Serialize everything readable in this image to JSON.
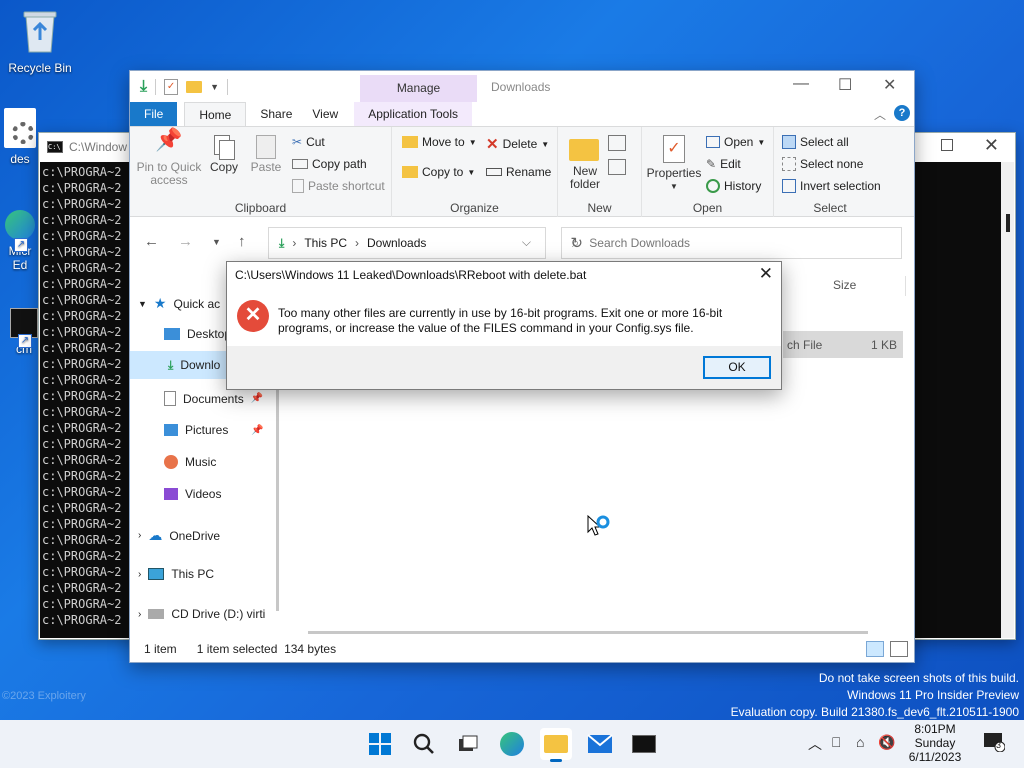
{
  "desktop": {
    "icons": [
      {
        "label": "Recycle Bin"
      },
      {
        "label": "des"
      },
      {
        "label": "Micr\nEd"
      },
      {
        "label": "cm"
      }
    ]
  },
  "cmd": {
    "title": "C:\\Window",
    "lines": [
      "c:\\PROGRA~2",
      "c:\\PROGRA~2",
      "c:\\PROGRA~2",
      "c:\\PROGRA~2",
      "c:\\PROGRA~2",
      "c:\\PROGRA~2",
      "c:\\PROGRA~2",
      "c:\\PROGRA~2",
      "c:\\PROGRA~2",
      "c:\\PROGRA~2",
      "c:\\PROGRA~2",
      "c:\\PROGRA~2",
      "c:\\PROGRA~2",
      "c:\\PROGRA~2",
      "c:\\PROGRA~2",
      "c:\\PROGRA~2",
      "c:\\PROGRA~2",
      "c:\\PROGRA~2",
      "c:\\PROGRA~2",
      "c:\\PROGRA~2",
      "c:\\PROGRA~2",
      "c:\\PROGRA~2",
      "c:\\PROGRA~2",
      "c:\\PROGRA~2",
      "c:\\PROGRA~2",
      "c:\\PROGRA~2",
      "c:\\PROGRA~2",
      "c:\\PROGRA~2",
      "c:\\PROGRA~2"
    ]
  },
  "explorer": {
    "context_tab": "Manage",
    "window_title": "Downloads",
    "tabs": {
      "file": "File",
      "home": "Home",
      "share": "Share",
      "view": "View",
      "app_tools": "Application Tools"
    },
    "ribbon": {
      "clipboard": {
        "label": "Clipboard",
        "pin": "Pin to Quick\naccess",
        "copy": "Copy",
        "paste": "Paste",
        "cut": "Cut",
        "copy_path": "Copy path",
        "paste_shortcut": "Paste shortcut"
      },
      "organize": {
        "label": "Organize",
        "move_to": "Move to",
        "copy_to": "Copy to",
        "delete": "Delete",
        "rename": "Rename"
      },
      "new": {
        "label": "New",
        "new_folder": "New\nfolder"
      },
      "open": {
        "label": "Open",
        "properties": "Properties",
        "open": "Open",
        "edit": "Edit",
        "history": "History"
      },
      "select": {
        "label": "Select",
        "select_all": "Select all",
        "select_none": "Select none",
        "invert": "Invert selection"
      }
    },
    "address": {
      "parts": [
        "This PC",
        "Downloads"
      ]
    },
    "search_placeholder": "Search Downloads",
    "nav": {
      "quick_access": "Quick ac",
      "desktop": "Desktop",
      "downloads": "Downlo",
      "documents": "Documents",
      "pictures": "Pictures",
      "music": "Music",
      "videos": "Videos",
      "onedrive": "OneDrive",
      "this_pc": "This PC",
      "cd_drive": "CD Drive (D:) virti"
    },
    "content": {
      "col_size": "Size",
      "row_type": "ch File",
      "row_size": "1 KB"
    },
    "status": {
      "items": "1 item",
      "selected": "1 item selected  134 bytes"
    }
  },
  "dialog": {
    "title": "C:\\Users\\Windows 11 Leaked\\Downloads\\RReboot with delete.bat",
    "message": "Too many other files are currently in use by 16-bit programs. Exit one or more 16-bit programs, or increase the value of the FILES command in your Config.sys file.",
    "ok": "OK"
  },
  "watermark": {
    "line1": "Do not take screen shots of this build.",
    "line2": "Windows 11 Pro Insider Preview",
    "line3": "Evaluation copy. Build 21380.fs_dev6_flt.210511-1900"
  },
  "copyright": "©2023 Exploitery",
  "taskbar": {
    "time": "8:01PM",
    "day": "Sunday",
    "date": "6/11/2023",
    "notifications": "3"
  }
}
